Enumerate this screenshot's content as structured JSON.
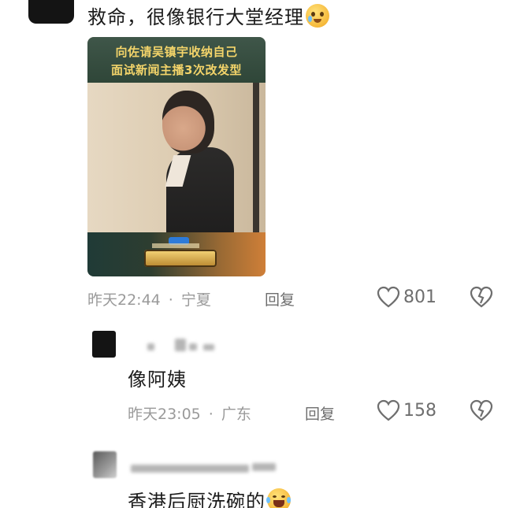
{
  "comments": [
    {
      "text": "救命，很像银行大堂经理",
      "emoji": "pleading-face-emoji",
      "video": {
        "caption_line1": "向佐请吴镇宇收纳自己",
        "caption_line2": "面试新闻主播3次改发型"
      },
      "time": "昨天22:44",
      "location": "宁夏",
      "reply_label": "回复",
      "likes": "801"
    },
    {
      "text": "像阿姨",
      "time": "昨天23:05",
      "location": "广东",
      "reply_label": "回复",
      "likes": "158"
    },
    {
      "text": "香港后厨洗碗的",
      "emoji": "laughing-tears-emoji"
    }
  ],
  "separator": "·",
  "colors": {
    "meta": "#9a9a9a",
    "icon": "#6e6e6e",
    "caption": "#f3d46a"
  }
}
